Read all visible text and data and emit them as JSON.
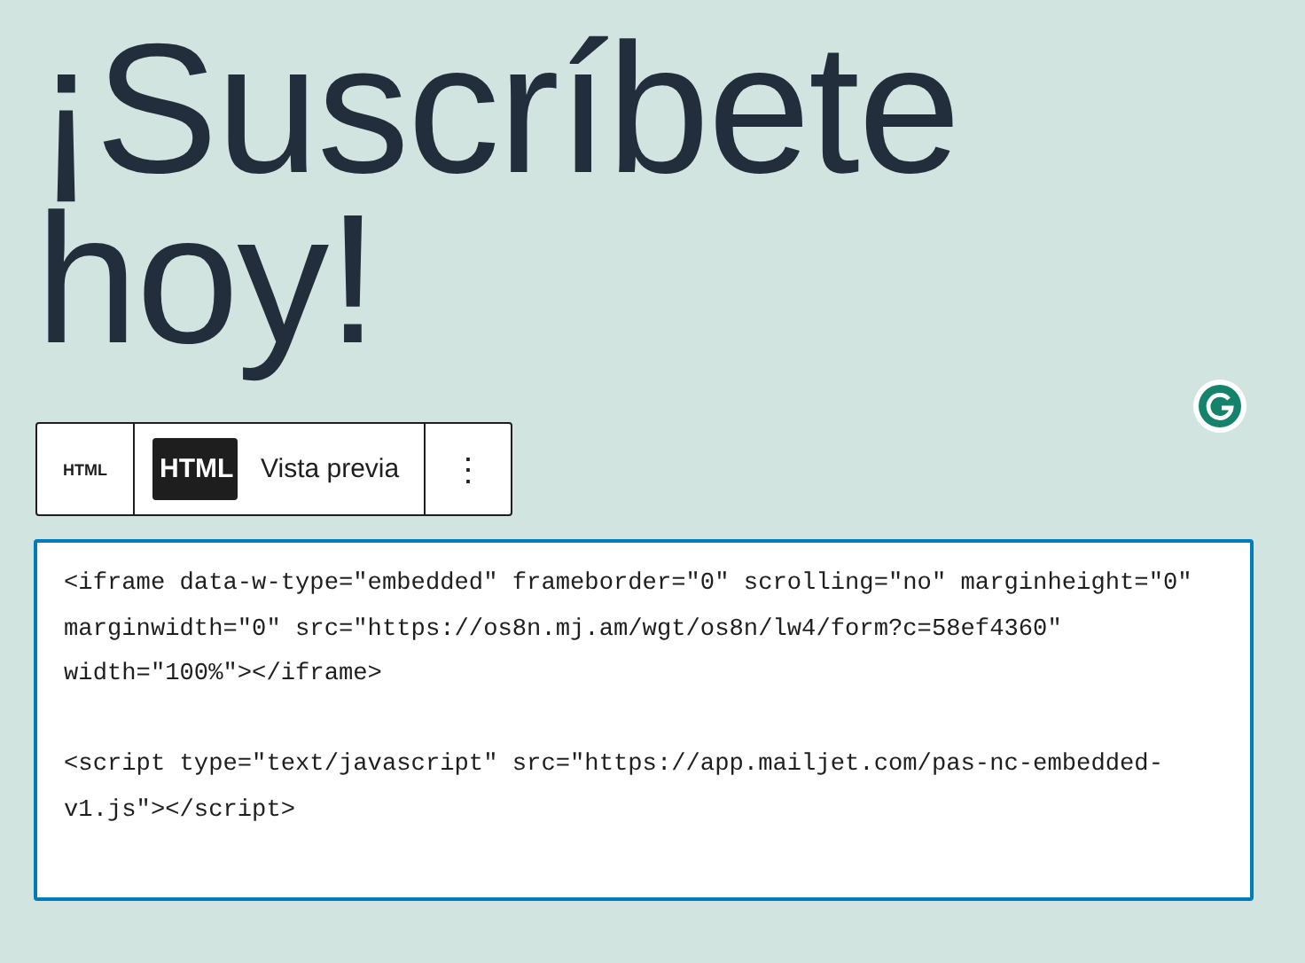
{
  "heading": "¡Suscríbete hoy!",
  "toolbar": {
    "block_button": "HTML",
    "tabs": [
      {
        "label": "HTML",
        "selected": true
      },
      {
        "label": "Vista previa",
        "selected": false
      }
    ],
    "more_button": "⋮"
  },
  "code": {
    "value": "<iframe data-w-type=\"embedded\" frameborder=\"0\" scrolling=\"no\" marginheight=\"0\" marginwidth=\"0\" src=\"https://os8n.mj.am/wgt/os8n/lw4/form?c=58ef4360\" width=\"100%\"></iframe>\n\n<script type=\"text/javascript\" src=\"https://app.mailjet.com/pas-nc-embedded-v1.js\"></script>",
    "focused": true
  }
}
